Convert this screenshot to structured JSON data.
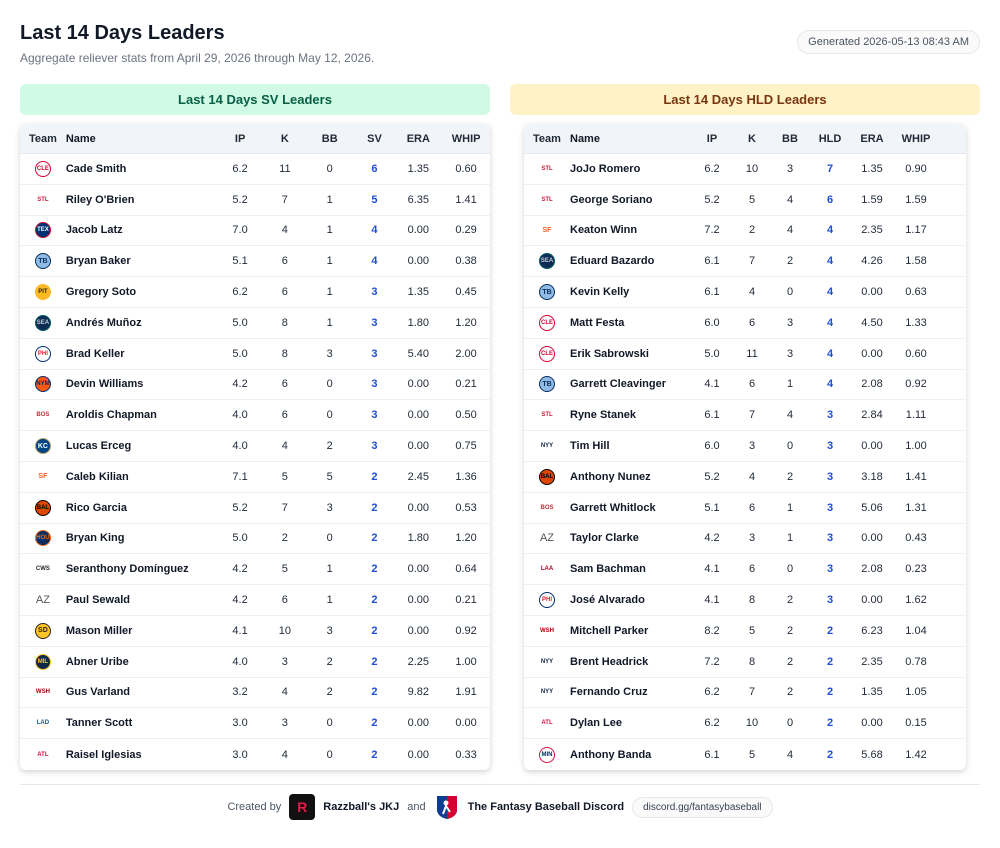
{
  "header": {
    "title": "Last 14 Days Leaders",
    "subtitle": "Aggregate reliever stats from April 29, 2026 through May 12, 2026.",
    "generated": "Generated 2026-05-13 08:43 AM"
  },
  "sv_panel": {
    "banner": "Last 14 Days SV Leaders",
    "columns": [
      "Team",
      "Name",
      "IP",
      "K",
      "BB",
      "SV",
      "ERA",
      "WHIP"
    ],
    "rows": [
      {
        "team": "CLE",
        "name": "Cade Smith",
        "ip": "6.2",
        "k": "11",
        "bb": "0",
        "stat": "6",
        "era": "1.35",
        "whip": "0.60"
      },
      {
        "team": "STL",
        "name": "Riley O'Brien",
        "ip": "5.2",
        "k": "7",
        "bb": "1",
        "stat": "5",
        "era": "6.35",
        "whip": "1.41"
      },
      {
        "team": "TEX",
        "name": "Jacob Latz",
        "ip": "7.0",
        "k": "4",
        "bb": "1",
        "stat": "4",
        "era": "0.00",
        "whip": "0.29"
      },
      {
        "team": "TB",
        "name": "Bryan Baker",
        "ip": "5.1",
        "k": "6",
        "bb": "1",
        "stat": "4",
        "era": "0.00",
        "whip": "0.38"
      },
      {
        "team": "PIT",
        "name": "Gregory Soto",
        "ip": "6.2",
        "k": "6",
        "bb": "1",
        "stat": "3",
        "era": "1.35",
        "whip": "0.45"
      },
      {
        "team": "SEA",
        "name": "Andrés Muñoz",
        "ip": "5.0",
        "k": "8",
        "bb": "1",
        "stat": "3",
        "era": "1.80",
        "whip": "1.20"
      },
      {
        "team": "PHI",
        "name": "Brad Keller",
        "ip": "5.0",
        "k": "8",
        "bb": "3",
        "stat": "3",
        "era": "5.40",
        "whip": "2.00"
      },
      {
        "team": "NYM",
        "name": "Devin Williams",
        "ip": "4.2",
        "k": "6",
        "bb": "0",
        "stat": "3",
        "era": "0.00",
        "whip": "0.21"
      },
      {
        "team": "BOS",
        "name": "Aroldis Chapman",
        "ip": "4.0",
        "k": "6",
        "bb": "0",
        "stat": "3",
        "era": "0.00",
        "whip": "0.50"
      },
      {
        "team": "KC",
        "name": "Lucas Erceg",
        "ip": "4.0",
        "k": "4",
        "bb": "2",
        "stat": "3",
        "era": "0.00",
        "whip": "0.75"
      },
      {
        "team": "SF",
        "name": "Caleb Kilian",
        "ip": "7.1",
        "k": "5",
        "bb": "5",
        "stat": "2",
        "era": "2.45",
        "whip": "1.36"
      },
      {
        "team": "BAL",
        "name": "Rico Garcia",
        "ip": "5.2",
        "k": "7",
        "bb": "3",
        "stat": "2",
        "era": "0.00",
        "whip": "0.53"
      },
      {
        "team": "HOU",
        "name": "Bryan King",
        "ip": "5.0",
        "k": "2",
        "bb": "0",
        "stat": "2",
        "era": "1.80",
        "whip": "1.20"
      },
      {
        "team": "CWS",
        "name": "Seranthony Domínguez",
        "ip": "4.2",
        "k": "5",
        "bb": "1",
        "stat": "2",
        "era": "0.00",
        "whip": "0.64"
      },
      {
        "team": "AZ",
        "name": "Paul Sewald",
        "ip": "4.2",
        "k": "6",
        "bb": "1",
        "stat": "2",
        "era": "0.00",
        "whip": "0.21"
      },
      {
        "team": "SD",
        "name": "Mason Miller",
        "ip": "4.1",
        "k": "10",
        "bb": "3",
        "stat": "2",
        "era": "0.00",
        "whip": "0.92"
      },
      {
        "team": "MIL",
        "name": "Abner Uribe",
        "ip": "4.0",
        "k": "3",
        "bb": "2",
        "stat": "2",
        "era": "2.25",
        "whip": "1.00"
      },
      {
        "team": "WSH",
        "name": "Gus Varland",
        "ip": "3.2",
        "k": "4",
        "bb": "2",
        "stat": "2",
        "era": "9.82",
        "whip": "1.91"
      },
      {
        "team": "LAD",
        "name": "Tanner Scott",
        "ip": "3.0",
        "k": "3",
        "bb": "0",
        "stat": "2",
        "era": "0.00",
        "whip": "0.00"
      },
      {
        "team": "ATL",
        "name": "Raisel Iglesias",
        "ip": "3.0",
        "k": "4",
        "bb": "0",
        "stat": "2",
        "era": "0.00",
        "whip": "0.33"
      }
    ]
  },
  "hld_panel": {
    "banner": "Last 14 Days HLD Leaders",
    "columns": [
      "Team",
      "Name",
      "IP",
      "K",
      "BB",
      "HLD",
      "ERA",
      "WHIP"
    ],
    "rows": [
      {
        "team": "STL",
        "name": "JoJo Romero",
        "ip": "6.2",
        "k": "10",
        "bb": "3",
        "stat": "7",
        "era": "1.35",
        "whip": "0.90"
      },
      {
        "team": "STL",
        "name": "George Soriano",
        "ip": "5.2",
        "k": "5",
        "bb": "4",
        "stat": "6",
        "era": "1.59",
        "whip": "1.59"
      },
      {
        "team": "SF",
        "name": "Keaton Winn",
        "ip": "7.2",
        "k": "2",
        "bb": "4",
        "stat": "4",
        "era": "2.35",
        "whip": "1.17"
      },
      {
        "team": "SEA",
        "name": "Eduard Bazardo",
        "ip": "6.1",
        "k": "7",
        "bb": "2",
        "stat": "4",
        "era": "4.26",
        "whip": "1.58"
      },
      {
        "team": "TB",
        "name": "Kevin Kelly",
        "ip": "6.1",
        "k": "4",
        "bb": "0",
        "stat": "4",
        "era": "0.00",
        "whip": "0.63"
      },
      {
        "team": "CLE",
        "name": "Matt Festa",
        "ip": "6.0",
        "k": "6",
        "bb": "3",
        "stat": "4",
        "era": "4.50",
        "whip": "1.33"
      },
      {
        "team": "CLE",
        "name": "Erik Sabrowski",
        "ip": "5.0",
        "k": "11",
        "bb": "3",
        "stat": "4",
        "era": "0.00",
        "whip": "0.60"
      },
      {
        "team": "TB",
        "name": "Garrett Cleavinger",
        "ip": "4.1",
        "k": "6",
        "bb": "1",
        "stat": "4",
        "era": "2.08",
        "whip": "0.92"
      },
      {
        "team": "STL",
        "name": "Ryne Stanek",
        "ip": "6.1",
        "k": "7",
        "bb": "4",
        "stat": "3",
        "era": "2.84",
        "whip": "1.11"
      },
      {
        "team": "NYY",
        "name": "Tim Hill",
        "ip": "6.0",
        "k": "3",
        "bb": "0",
        "stat": "3",
        "era": "0.00",
        "whip": "1.00"
      },
      {
        "team": "BAL",
        "name": "Anthony Nunez",
        "ip": "5.2",
        "k": "4",
        "bb": "2",
        "stat": "3",
        "era": "3.18",
        "whip": "1.41"
      },
      {
        "team": "BOS",
        "name": "Garrett Whitlock",
        "ip": "5.1",
        "k": "6",
        "bb": "1",
        "stat": "3",
        "era": "5.06",
        "whip": "1.31"
      },
      {
        "team": "AZ",
        "name": "Taylor Clarke",
        "ip": "4.2",
        "k": "3",
        "bb": "1",
        "stat": "3",
        "era": "0.00",
        "whip": "0.43"
      },
      {
        "team": "LAA",
        "name": "Sam Bachman",
        "ip": "4.1",
        "k": "6",
        "bb": "0",
        "stat": "3",
        "era": "2.08",
        "whip": "0.23"
      },
      {
        "team": "PHI",
        "name": "José Alvarado",
        "ip": "4.1",
        "k": "8",
        "bb": "2",
        "stat": "3",
        "era": "0.00",
        "whip": "1.62"
      },
      {
        "team": "WSH",
        "name": "Mitchell Parker",
        "ip": "8.2",
        "k": "5",
        "bb": "2",
        "stat": "2",
        "era": "6.23",
        "whip": "1.04"
      },
      {
        "team": "NYY",
        "name": "Brent Headrick",
        "ip": "7.2",
        "k": "8",
        "bb": "2",
        "stat": "2",
        "era": "2.35",
        "whip": "0.78"
      },
      {
        "team": "NYY",
        "name": "Fernando Cruz",
        "ip": "6.2",
        "k": "7",
        "bb": "2",
        "stat": "2",
        "era": "1.35",
        "whip": "1.05"
      },
      {
        "team": "ATL",
        "name": "Dylan Lee",
        "ip": "6.2",
        "k": "10",
        "bb": "0",
        "stat": "2",
        "era": "0.00",
        "whip": "0.15"
      },
      {
        "team": "MIN",
        "name": "Anthony Banda",
        "ip": "6.1",
        "k": "5",
        "bb": "4",
        "stat": "2",
        "era": "5.68",
        "whip": "1.42"
      }
    ]
  },
  "team_logos": {
    "CLE": {
      "glyph": "C",
      "bg": "#ffffff",
      "fg": "#d50032",
      "border": "#d50032"
    },
    "STL": {
      "glyph": "🐦",
      "bg": "#ffffff",
      "fg": "#c41e3a",
      "border": "#ffffff"
    },
    "TEX": {
      "glyph": "T",
      "bg": "#003278",
      "fg": "#ffffff",
      "border": "#c0111f"
    },
    "TB": {
      "glyph": "TB",
      "bg": "#8fbce6",
      "fg": "#092c5c",
      "border": "#092c5c"
    },
    "PIT": {
      "glyph": "P",
      "bg": "#fdb827",
      "fg": "#27251f",
      "border": "#fdb827"
    },
    "SEA": {
      "glyph": "S",
      "bg": "#0c2c56",
      "fg": "#c4ced4",
      "border": "#005c5c"
    },
    "PHI": {
      "glyph": "P",
      "bg": "#ffffff",
      "fg": "#e81828",
      "border": "#002d72"
    },
    "NYM": {
      "glyph": "M",
      "bg": "#ff5910",
      "fg": "#002d72",
      "border": "#002d72"
    },
    "BOS": {
      "glyph": "B",
      "bg": "#ffffff",
      "fg": "#bd3039",
      "border": "#ffffff"
    },
    "KC": {
      "glyph": "KC",
      "bg": "#004687",
      "fg": "#ffffff",
      "border": "#bd9b60"
    },
    "SF": {
      "glyph": "SF",
      "bg": "#ffffff",
      "fg": "#fd5a1e",
      "border": "#ffffff"
    },
    "BAL": {
      "glyph": "B",
      "bg": "#df4601",
      "fg": "#000000",
      "border": "#000000"
    },
    "HOU": {
      "glyph": "H",
      "bg": "#002d62",
      "fg": "#eb6e1f",
      "border": "#eb6e1f"
    },
    "CWS": {
      "glyph": "SOX",
      "bg": "#ffffff",
      "fg": "#27251f",
      "border": "#ffffff"
    },
    "AZ": {
      "glyph": "AZ",
      "bg": "",
      "fg": "#555555",
      "border": ""
    },
    "SD": {
      "glyph": "SD",
      "bg": "#ffc425",
      "fg": "#2f241d",
      "border": "#2f241d"
    },
    "MIL": {
      "glyph": "M",
      "bg": "#12284b",
      "fg": "#ffc52f",
      "border": "#ffc52f"
    },
    "WSH": {
      "glyph": "W",
      "bg": "#ffffff",
      "fg": "#ab0003",
      "border": "#ffffff"
    },
    "LAD": {
      "glyph": "LA",
      "bg": "#ffffff",
      "fg": "#005a9c",
      "border": "#ffffff"
    },
    "ATL": {
      "glyph": "A",
      "bg": "#ffffff",
      "fg": "#ce1141",
      "border": "#ffffff"
    },
    "NYY": {
      "glyph": "NY",
      "bg": "#ffffff",
      "fg": "#0c2340",
      "border": "#ffffff"
    },
    "LAA": {
      "glyph": "A",
      "bg": "#ffffff",
      "fg": "#ba0021",
      "border": "#ffffff"
    },
    "MIN": {
      "glyph": "TC",
      "bg": "#ffffff",
      "fg": "#002b5c",
      "border": "#d31145"
    }
  },
  "footer": {
    "created_by": "Created by",
    "brand1": "Razzball's JKJ",
    "and": "and",
    "brand2": "The Fantasy Baseball Discord",
    "link": "discord.gg/fantasybaseball"
  },
  "colors": {
    "sv_banner_bg": "#d1fae5",
    "hld_banner_bg": "#fef3c7",
    "highlight_stat": "#1d4ed8"
  }
}
